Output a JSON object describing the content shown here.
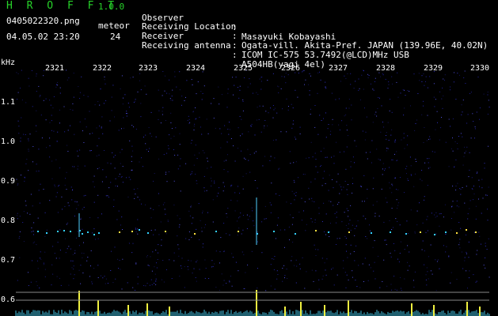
{
  "app": {
    "title": "H R O F F T",
    "version": "1.0.0"
  },
  "file": {
    "name": "0405022320.png",
    "datetime": "04.05.02 23:20"
  },
  "meteor": {
    "label": "meteor",
    "count": "24"
  },
  "info": [
    {
      "key": "Observer",
      "value": "Masayuki Kobayashi"
    },
    {
      "key": "Receiving Location",
      "value": "Ogata-vill. Akita-Pref. JAPAN (139.96E, 40.02N)"
    },
    {
      "key": "Receiver",
      "value": "ICOM IC-575 53.7492(@LCD)MHz USB"
    },
    {
      "key": "Receiving antenna",
      "value": "A504HB(yagi 4el)"
    }
  ],
  "axis": {
    "y_unit": "kHz",
    "x_ticks": [
      "2321",
      "2322",
      "2323",
      "2324",
      "2325",
      "2326",
      "2327",
      "2328",
      "2329",
      "2330"
    ],
    "y_ticks": [
      "1.1",
      "1.0",
      "0.9",
      "0.8",
      "0.7",
      "0.6"
    ]
  },
  "colors": {
    "header_green": "#27d32a",
    "background": "#000000",
    "noise": "#1a1a7a",
    "echo": "#33d0ff"
  }
}
